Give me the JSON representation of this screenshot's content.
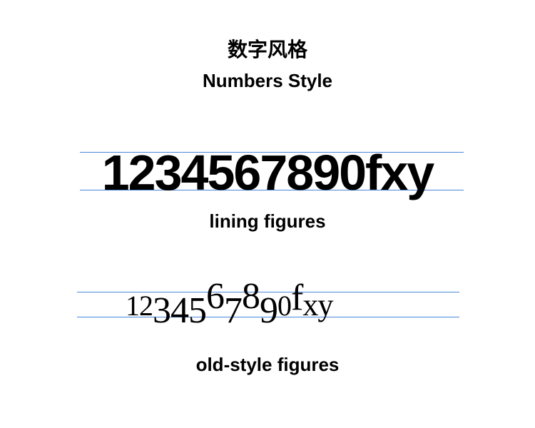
{
  "title_cn": "数字风格",
  "title_en": "Numbers Style",
  "lining": {
    "sample": "1234567890fxy",
    "caption": "lining figures"
  },
  "oldstyle": {
    "sample": "1234567890fxy",
    "caption": "old-style figures"
  },
  "colors": {
    "guide_line": "#4a86d8",
    "text": "#000000",
    "background": "#ffffff"
  }
}
